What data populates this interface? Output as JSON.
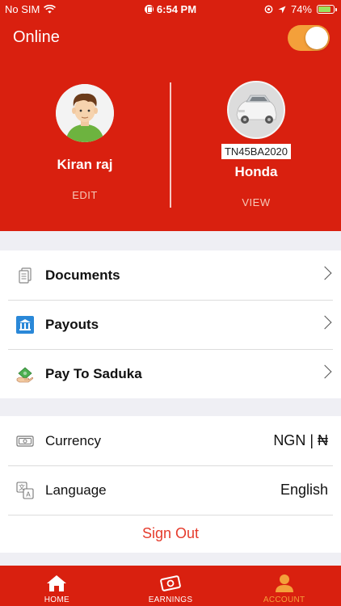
{
  "status_bar": {
    "carrier": "No SIM",
    "time": "6:54 PM",
    "battery": "74%"
  },
  "header": {
    "online_label": "Online",
    "profile": {
      "name": "Kiran raj",
      "action": "EDIT"
    },
    "vehicle": {
      "plate": "TN45BA2020",
      "name": "Honda",
      "action": "VIEW"
    }
  },
  "menu": {
    "items": [
      {
        "label": "Documents",
        "icon": "documents-icon"
      },
      {
        "label": "Payouts",
        "icon": "bank-icon"
      },
      {
        "label": "Pay To Saduka",
        "icon": "money-hand-icon"
      }
    ]
  },
  "settings": {
    "currency_label": "Currency",
    "currency_value": "NGN | ₦",
    "language_label": "Language",
    "language_value": "English",
    "signout_label": "Sign Out"
  },
  "tabs": [
    {
      "label": "HOME",
      "icon": "home-icon"
    },
    {
      "label": "EARNINGS",
      "icon": "earnings-icon"
    },
    {
      "label": "ACCOUNT",
      "icon": "account-icon"
    }
  ],
  "colors": {
    "primary": "#d9200f",
    "accent": "#f4a03a",
    "signout": "#e53b2c",
    "background": "#efeff4"
  }
}
